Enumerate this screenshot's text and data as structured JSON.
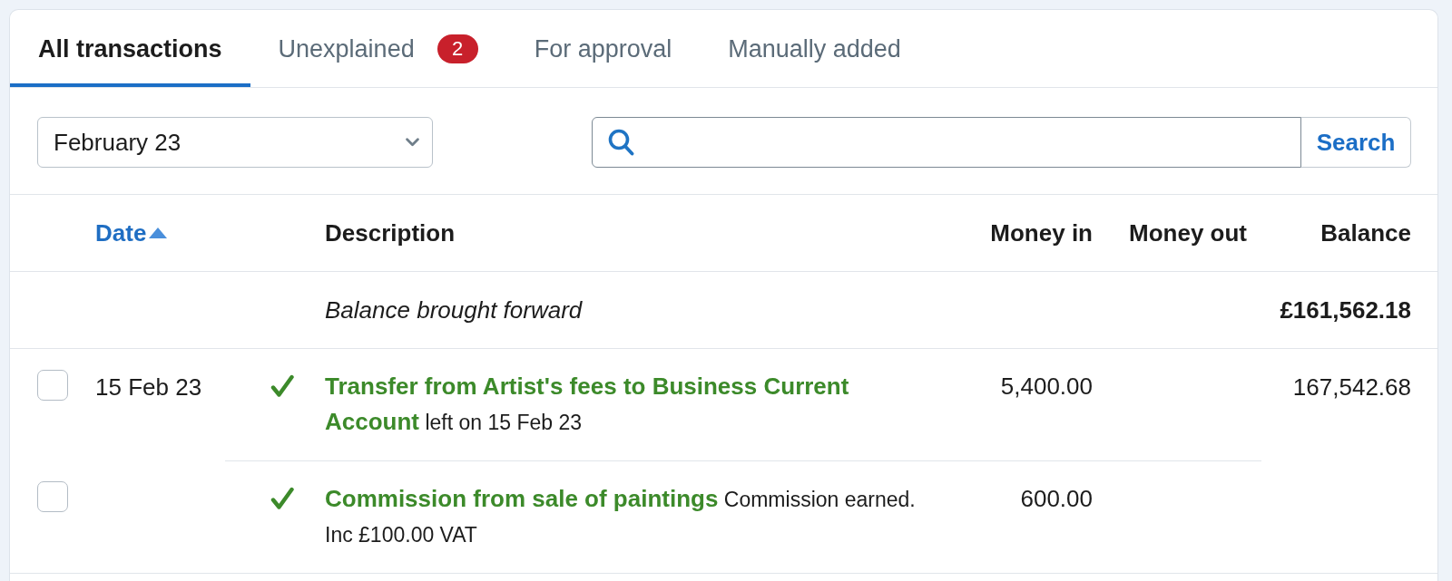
{
  "tabs": [
    {
      "label": "All transactions",
      "selected": true
    },
    {
      "label": "Unexplained",
      "selected": false,
      "badge": "2"
    },
    {
      "label": "For approval",
      "selected": false
    },
    {
      "label": "Manually added",
      "selected": false
    }
  ],
  "filters": {
    "period": {
      "value": "February 23"
    },
    "search": {
      "button": "Search"
    }
  },
  "table": {
    "columns": [
      {
        "label": "Date",
        "sorted": true,
        "descending": false
      },
      {
        "label": "Description"
      },
      {
        "label": "Money in"
      },
      {
        "label": "Money out"
      },
      {
        "label": "Balance"
      }
    ],
    "opening_row": {
      "description": "Balance brought forward",
      "balance": "£161,562.18"
    },
    "groups": [
      {
        "date": "15 Feb 23",
        "balance": "167,542.68",
        "lines": [
          {
            "checked": false,
            "explained": true,
            "description": "**Transfer from Artist's fees to Business Current Account** left on 15 Feb 23",
            "money_in": "5,400.00"
          },
          {
            "checked": false,
            "explained": true,
            "description": "**Commission from sale of paintings** Commission earned. Inc £100.00 VAT",
            "money_in": "600.00"
          }
        ]
      }
    ]
  }
}
